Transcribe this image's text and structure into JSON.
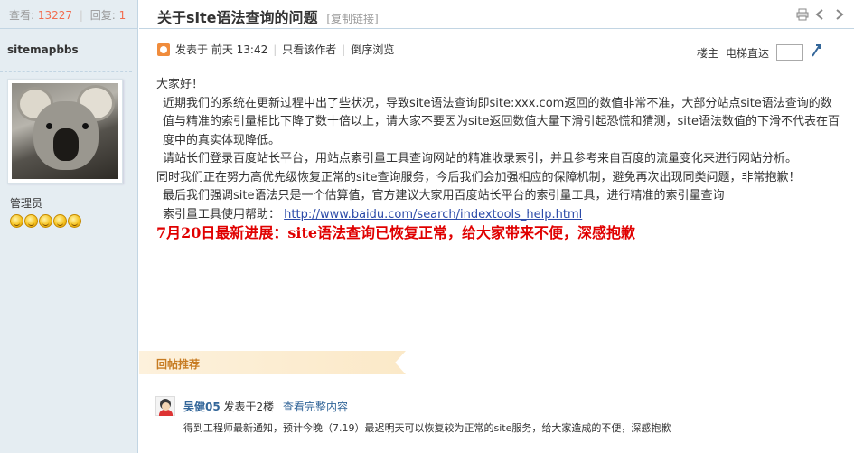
{
  "stats": {
    "views_label": "查看:",
    "views": "13227",
    "sep": "|",
    "replies_label": "回复:",
    "replies": "1"
  },
  "author": {
    "name": "sitemapbbs",
    "role": "管理员"
  },
  "thread": {
    "title": "关于site语法查询的问题",
    "copy_link": "[复制链接]"
  },
  "post_meta": {
    "posted": "发表于 前天 13:42",
    "only_author": "只看该作者",
    "reverse": "倒序浏览",
    "pipe": "|"
  },
  "floor": {
    "label": "楼主",
    "jump_label": "电梯直达"
  },
  "content": {
    "greeting": "大家好！",
    "p1": "近期我们的系统在更新过程中出了些状况，导致site语法查询即site:xxx.com返回的数值非常不准，大部分站点site语法查询的数值与精准的索引量相比下降了数十倍以上，请大家不要因为site返回数值大量下滑引起恐慌和猜测，site语法数值的下滑不代表在百度中的真实体现降低。",
    "p2": "请站长们登录百度站长平台，用站点索引量工具查询网站的精准收录索引，并且参考来自百度的流量变化来进行网站分析。",
    "p3": "同时我们正在努力高优先级恢复正常的site查询服务，今后我们会加强相应的保障机制，避免再次出现同类问题，非常抱歉！",
    "p4": "最后我们强调site语法只是一个估算值，官方建议大家用百度站长平台的索引量工具，进行精准的索引量查询",
    "help_label": "索引量工具使用帮助：",
    "help_url": "http://www.baidu.com/search/indextools_help.html",
    "progress": "7月20日最新进展：site语法查询已恢复正常，给大家带来不便，深感抱歉"
  },
  "recommend": {
    "label": "回帖推荐"
  },
  "reply": {
    "user": "吴健05",
    "posted": "发表于2楼",
    "view_full": "查看完整内容",
    "text": "得到工程师最新通知，预计今晚（7.19）最迟明天可以恢复较为正常的site服务，给大家造成的不便，深感抱歉"
  },
  "icons": {
    "print": "print-icon",
    "prev": "prev-thread-icon",
    "next": "next-thread-icon",
    "jump": "jump-arrow-icon",
    "online": "online-status-icon"
  },
  "colors": {
    "accent": "#f26c4f",
    "link": "#336699",
    "alert": "#e00000",
    "sidebar_bg": "#e5edf2"
  }
}
